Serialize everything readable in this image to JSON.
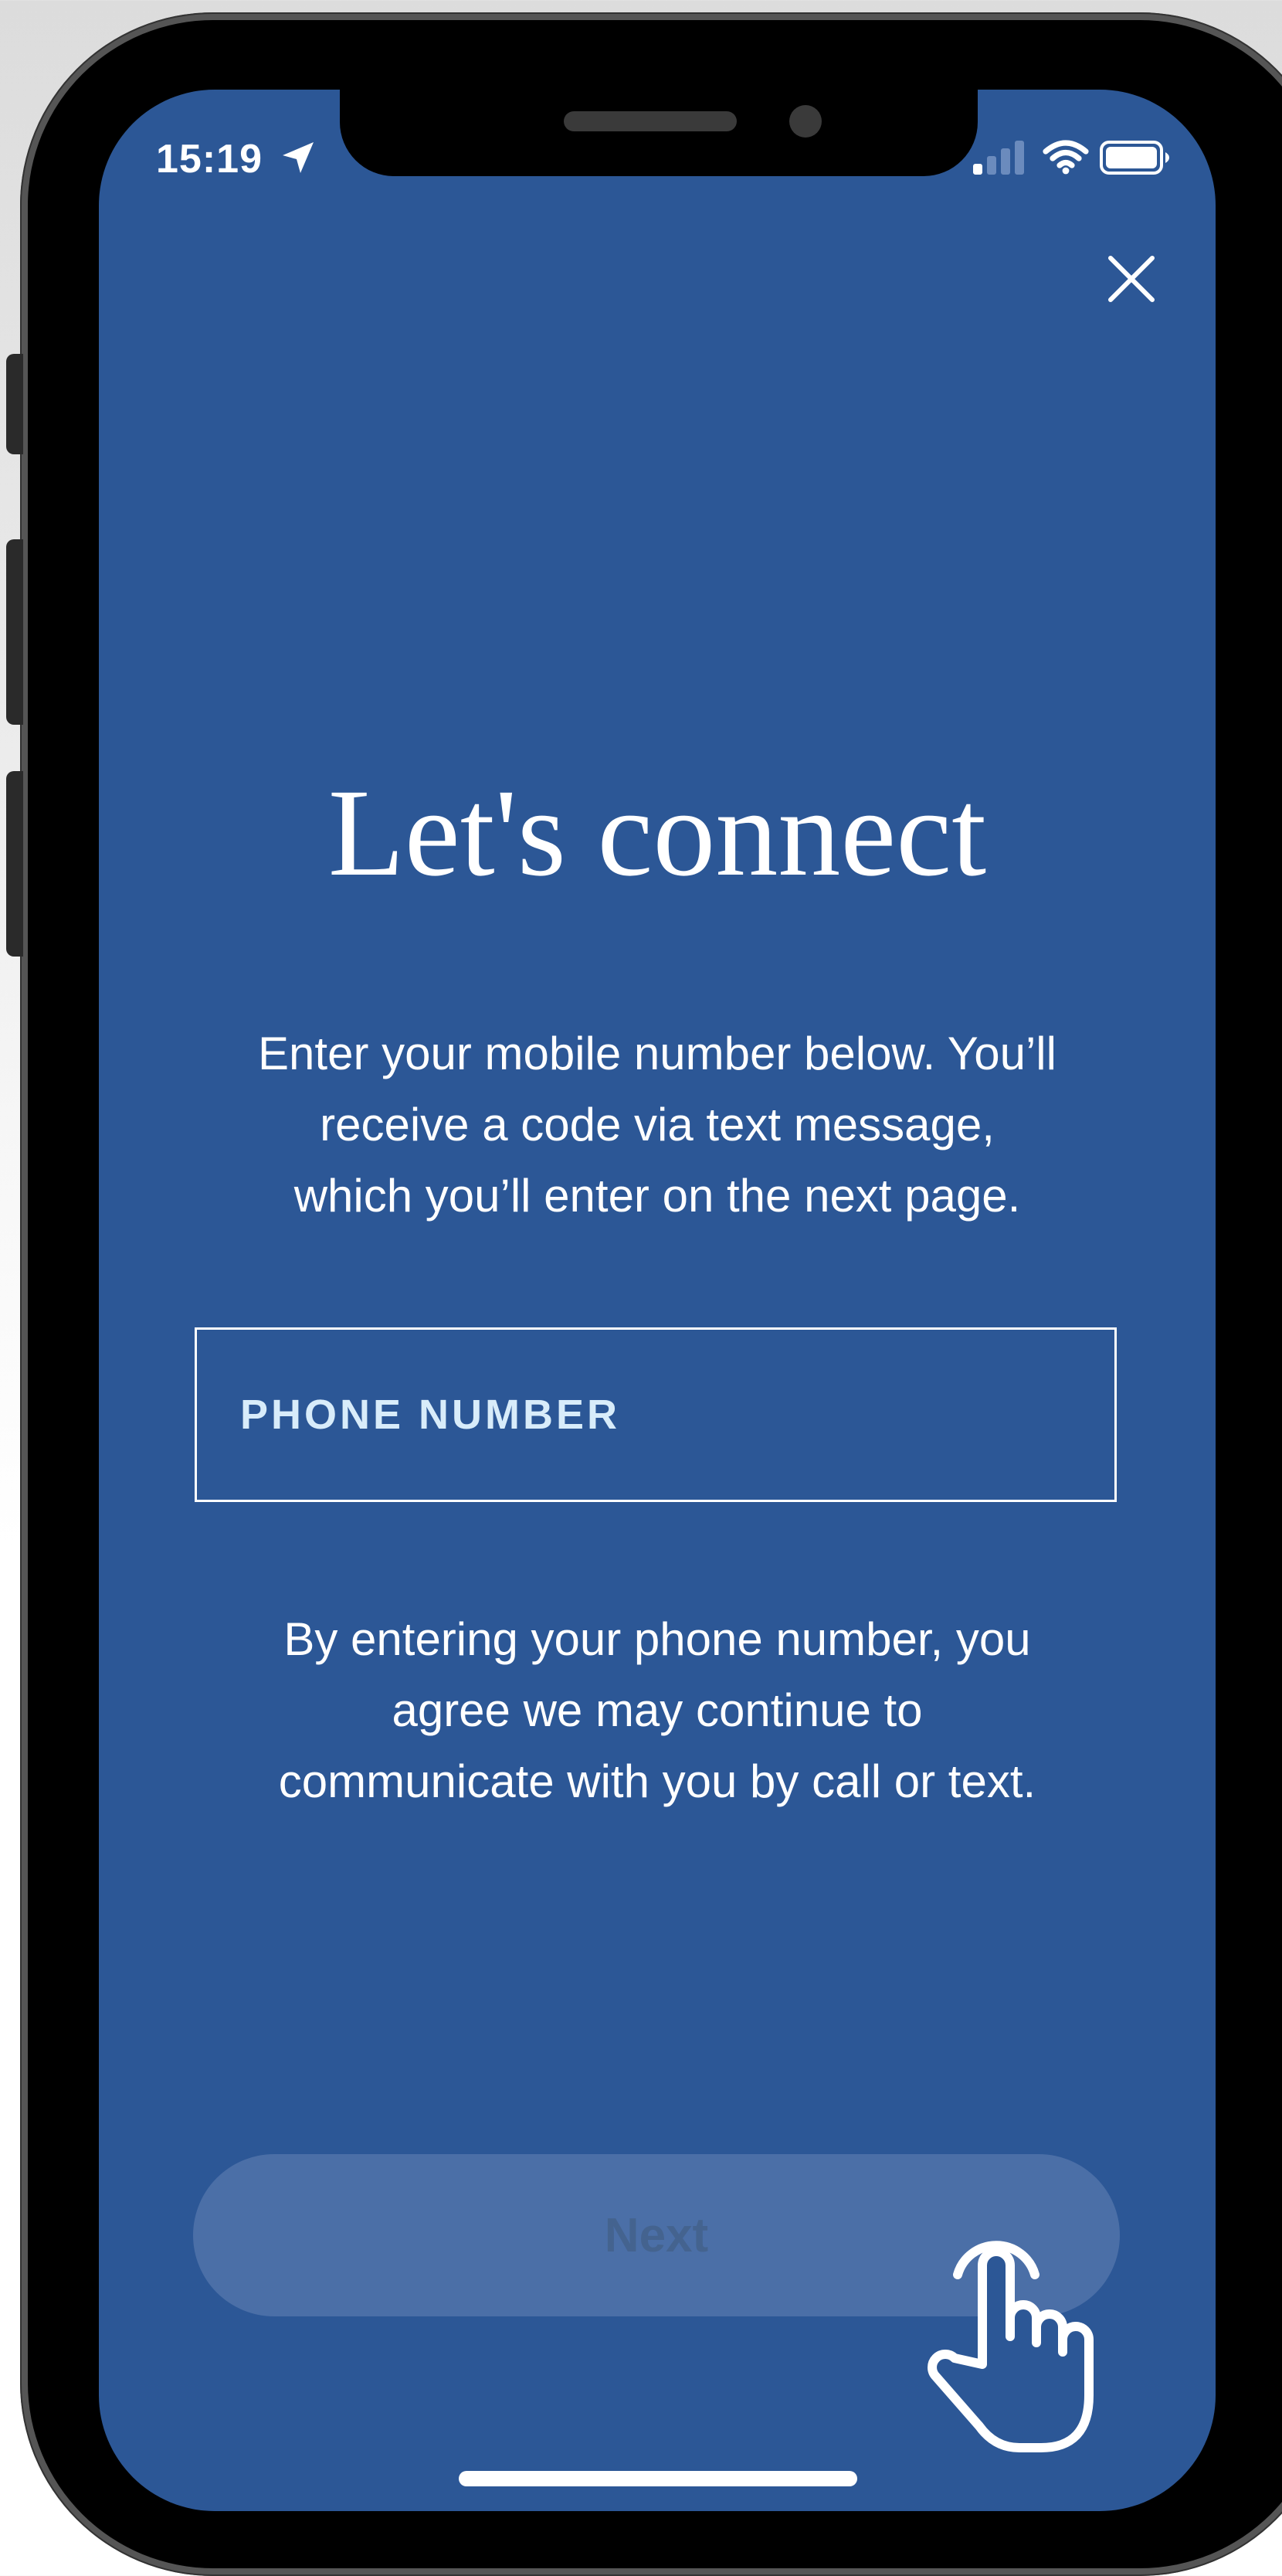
{
  "status_bar": {
    "time": "15:19",
    "location_icon": "location-arrow-icon",
    "signal_icon": "cellular-signal-icon",
    "wifi_icon": "wifi-icon",
    "battery_icon": "battery-icon"
  },
  "header": {
    "close_icon": "close-icon"
  },
  "main": {
    "title": "Let's connect",
    "intro_lines": [
      "Enter your mobile number below. You’ll",
      "receive a code via text message,",
      "which you’ll enter on the next page."
    ],
    "phone_field": {
      "placeholder": "PHONE NUMBER",
      "value": ""
    },
    "consent_lines": [
      "By entering your phone number, you",
      "agree we may continue to",
      "communicate with you by call or text."
    ],
    "next_label": "Next",
    "pointer_icon": "hand-pointer-icon"
  },
  "colors": {
    "screen_background": "#2c5796",
    "button_background": "#4b6fa7",
    "button_text": "#44638f",
    "placeholder_text": "#d8ecfa"
  }
}
